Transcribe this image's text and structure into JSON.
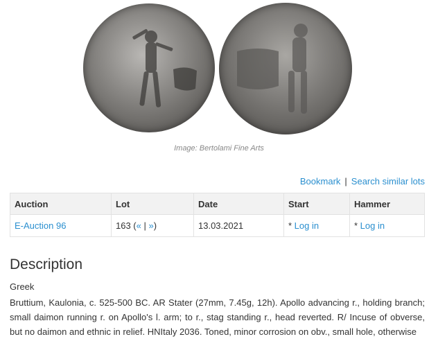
{
  "image": {
    "obverse_alt": "coin-obverse",
    "reverse_alt": "coin-reverse",
    "caption": "Image: Bertolami Fine Arts"
  },
  "actions": {
    "bookmark": "Bookmark",
    "separator": "|",
    "search_similar": "Search similar lots"
  },
  "table": {
    "headers": [
      "Auction",
      "Lot",
      "Date",
      "Start",
      "Hammer"
    ],
    "row": {
      "auction": "E-Auction 96",
      "lot_number": "163 (",
      "prev": "«",
      "pipe": " | ",
      "next": "»",
      "lot_close": ")",
      "date": "13.03.2021",
      "start_prefix": "* ",
      "start_link": "Log in",
      "hammer_prefix": "* ",
      "hammer_link": "Log in"
    }
  },
  "description": {
    "title": "Description",
    "category": "Greek",
    "text": "Bruttium, Kaulonia, c. 525-500 BC. AR Stater (27mm, 7.45g, 12h). Apollo advancing r., holding branch; small daimon running r. on Apollo's l. arm; to r., stag standing r., head reverted. R/ Incuse of obverse, but no daimon and ethnic in relief. HNItaly 2036. Toned, minor corrosion on obv., small hole, otherwise"
  }
}
